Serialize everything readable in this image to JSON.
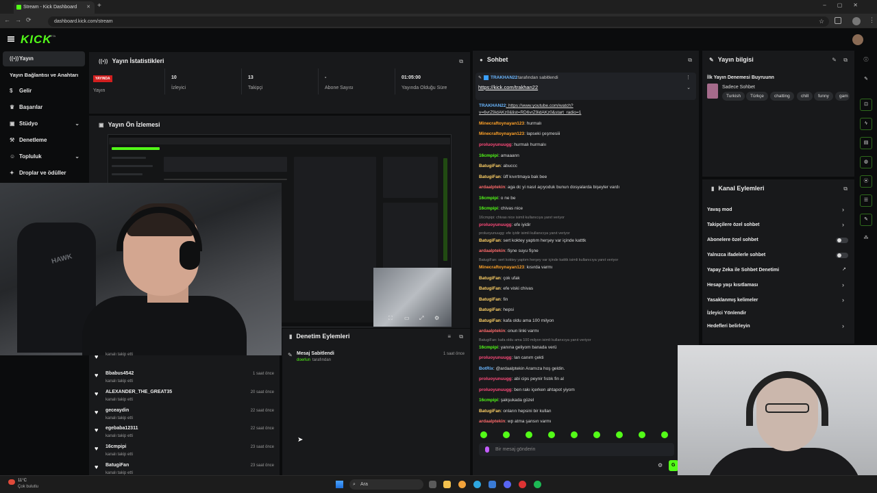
{
  "browser": {
    "tab_title": "Stream - Kick Dashboard",
    "url": "dashboard.kick.com/stream"
  },
  "brand": {
    "logo": "KICK",
    "beta": "BETA",
    "accent": "#53fc18"
  },
  "sidebar": {
    "items": [
      {
        "label": "Yayın",
        "icon": "broadcast-icon"
      },
      {
        "label": "Yayın Bağlantısı ve Anahtarı",
        "icon": ""
      },
      {
        "label": "Gelir",
        "icon": "dollar-icon"
      },
      {
        "label": "Başarılar",
        "icon": "trophy-icon"
      },
      {
        "label": "Stüdyo",
        "icon": "studio-icon"
      },
      {
        "label": "Denetleme",
        "icon": "hammer-icon"
      },
      {
        "label": "Topluluk",
        "icon": "community-icon"
      },
      {
        "label": "Droplar ve ödüller",
        "icon": "gift-icon"
      }
    ]
  },
  "stats": {
    "title": "Yayın İstatistikleri",
    "live_badge": "YAYINDA",
    "live_label": "Yayın",
    "items": [
      {
        "value": "10",
        "label": "İzleyici"
      },
      {
        "value": "13",
        "label": "Takipçi"
      },
      {
        "value": "-",
        "label": "Abone Sayısı"
      },
      {
        "value": "01:05:00",
        "label": "Yayında Olduğu Süre"
      }
    ]
  },
  "preview": {
    "title": "Yayın Ön İzlemesi"
  },
  "moderation": {
    "title": "Denetim Eylemleri",
    "entry": {
      "title": "Mesaj Sabitlendi",
      "by": "doerlun",
      "suffix": "tarafından",
      "time": "1 saat önce"
    }
  },
  "follows": [
    {
      "name": "",
      "sub": "kanalı takip etti",
      "time": ""
    },
    {
      "name": "Bbabus4542",
      "sub": "kanalı takip etti",
      "time": "1 saat önce"
    },
    {
      "name": "ALEXANDER_THE_GREAT35",
      "sub": "kanalı takip etti",
      "time": "20 saat önce"
    },
    {
      "name": "geceaydin",
      "sub": "kanalı takip etti",
      "time": "22 saat önce"
    },
    {
      "name": "egebaba12311",
      "sub": "kanalı takip etti",
      "time": "22 saat önce"
    },
    {
      "name": "16cmpipi",
      "sub": "kanalı takip etti",
      "time": "23 saat önce"
    },
    {
      "name": "BatugiFan",
      "sub": "kanalı takip etti",
      "time": "23 saat önce"
    }
  ],
  "chat": {
    "title": "Sohbet",
    "pinned": {
      "user": "TRAKHAN22",
      "suffix": "tarafından sabitlendi",
      "link": "https://kick.com/trakhan22"
    },
    "messages": [
      {
        "user": "TRAKHAN22",
        "color": "#6ab7ff",
        "text": ": https://www.youtube.com/watch?"
      },
      {
        "user": "",
        "color": "#ddd",
        "text": "v=6vrZ9idAKz0&list=RD6vrZ9idAKz0&start_radio=1"
      },
      {
        "user": "Minecraftoynayan123",
        "color": "#ffa229",
        "text": ": hurmalı"
      },
      {
        "user": "Minecraftoynayan123",
        "color": "#ffa229",
        "text": ": lapseki çeşmesiii"
      },
      {
        "user": "proluoyunuugg",
        "color": "#ff4a7a",
        "text": ": hurmalı hurmalıı"
      },
      {
        "user": "16cmpipi",
        "color": "#53fc18",
        "text": ": amaaann"
      },
      {
        "user": "BatugiFan",
        "color": "#ffd166",
        "text": ": abuccc"
      },
      {
        "user": "BatugiFan",
        "color": "#ffd166",
        "text": ": üff kıvırtmaya bak bee"
      },
      {
        "user": "ardaalptekin",
        "color": "#ff6b6b",
        "text": ": aga dc yi nasıl açıyoduk bunun dosyalarda bişeyler vardı"
      },
      {
        "user": "16cmpipi",
        "color": "#53fc18",
        "text": ": o ne be"
      },
      {
        "user": "16cmpipi",
        "color": "#53fc18",
        "text": ": chivas nice"
      },
      {
        "reply": "16cmpipi: chivas nice isimli kullanıcıya yanıt veriyor"
      },
      {
        "user": "proluoyunuugg",
        "color": "#ff4a7a",
        "text": ": efe iyidir"
      },
      {
        "reply": "proluoyunuugg: efe iyidir isimli kullanıcıya yanıt veriyor"
      },
      {
        "user": "BatugiFan",
        "color": "#ffd166",
        "text": ": sert koktey yaptım herşey var içinde katttk"
      },
      {
        "user": "ardaalptekin",
        "color": "#ff6b6b",
        "text": ": fişne suyu fişne"
      },
      {
        "reply": "BatugiFan: sert koktey yaptım herşey var içinde katttk isimli kullanıcıya yanıt veriyor"
      },
      {
        "user": "Minecraftoynayan123",
        "color": "#ffa229",
        "text": ": kısırda varmı"
      },
      {
        "user": "BatugiFan",
        "color": "#ffd166",
        "text": ": çok ufak"
      },
      {
        "user": "BatugiFan",
        "color": "#ffd166",
        "text": ": efe viski chivas"
      },
      {
        "user": "BatugiFan",
        "color": "#ffd166",
        "text": ": fin"
      },
      {
        "user": "BatugiFan",
        "color": "#ffd166",
        "text": ": hepsi"
      },
      {
        "user": "BatugiFan",
        "color": "#ffd166",
        "text": ": kafa oldu ama 100 milyon"
      },
      {
        "user": "ardaalptekin",
        "color": "#ff6b6b",
        "text": ": onun linki varmı"
      },
      {
        "reply": "BatugiFan: kafa oldu ama 100 milyon isimli kullanıcıya yanıt veriyor"
      },
      {
        "user": "16cmpipi",
        "color": "#53fc18",
        "text": ": yanına geliyom banada verü"
      },
      {
        "user": "proluoyunuugg",
        "color": "#ff4a7a",
        "text": ": lan canım çekti"
      },
      {
        "user": "BotRix",
        "color": "#6ab7ff",
        "text": ": @ardaalptekin Aramıza hoş geldin."
      },
      {
        "user": "proluoyunuugg",
        "color": "#ff4a7a",
        "text": ": abi cips peynir fıstık fin al"
      },
      {
        "user": "proluoyunuugg",
        "color": "#ff4a7a",
        "text": ": ben rakı içerken ahtapot yiyom"
      },
      {
        "user": "16cmpipi",
        "color": "#53fc18",
        "text": ": şakşukada güzel"
      },
      {
        "user": "BatugiFan",
        "color": "#ffd166",
        "text": ": onların hepsini bir kullan"
      },
      {
        "user": "ardaalptekin",
        "color": "#ff6b6b",
        "text": ": wp atma şansın varmı"
      }
    ],
    "input_placeholder": "Bir mesaj gönderin",
    "send_label": "G"
  },
  "stream_info": {
    "title": "Yayın bilgisi",
    "stream_title": "İlk Yayın Denemesi Buyruunn",
    "category": "Sadece Sohbet",
    "tags": [
      "Turkish",
      "Türkçe",
      "chatting",
      "chill",
      "funny",
      "gam"
    ]
  },
  "channel_actions": {
    "title": "Kanal Eylemleri",
    "items": [
      {
        "label": "Yavaş mod",
        "control": "chevron"
      },
      {
        "label": "Takipçilere özel sohbet",
        "control": "chevron"
      },
      {
        "label": "Abonelere özel sohbet",
        "control": "toggle"
      },
      {
        "label": "Yalnızca ifadelerle sohbet",
        "control": "toggle"
      },
      {
        "label": "Yapay Zeka ile Sohbet Denetimi",
        "control": "external"
      },
      {
        "label": "Hesap yaşı kısıtlaması",
        "control": "chevron"
      },
      {
        "label": "Yasaklanmış kelimeler",
        "control": "chevron"
      },
      {
        "label": "İzleyici Yönlendir",
        "control": "none"
      },
      {
        "label": "Hedefleri belirleyin",
        "control": "chevron"
      }
    ]
  },
  "webcam_logo": "HAWK",
  "taskbar": {
    "temp": "11°C",
    "weather": "Çok bulutlu",
    "search": "Ara"
  }
}
